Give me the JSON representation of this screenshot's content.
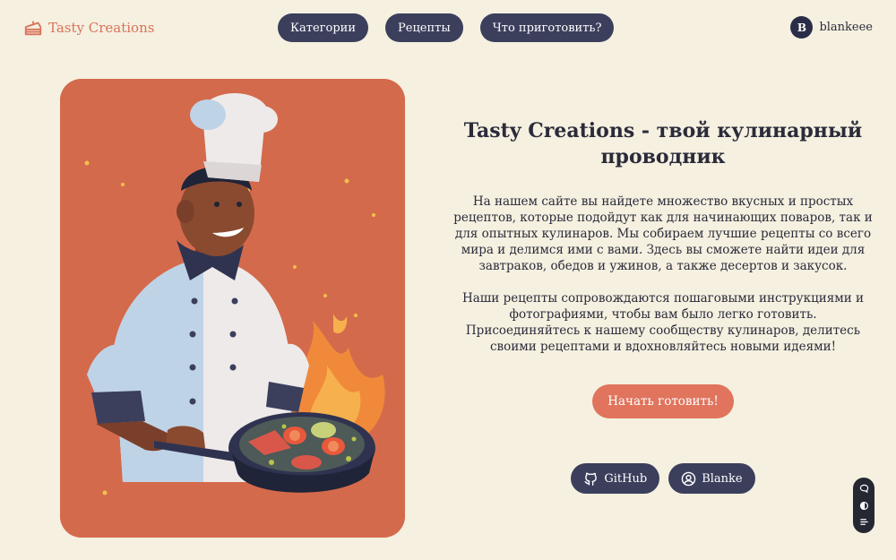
{
  "header": {
    "logo_text": "Tasty Creations",
    "logo_icon": "cake-slice-icon",
    "nav": [
      {
        "label": "Категории"
      },
      {
        "label": "Рецепты"
      },
      {
        "label": "Что приготовить?"
      }
    ],
    "user": {
      "initial": "B",
      "name": "blankeee"
    }
  },
  "hero": {
    "image": "chef-cooking-illustration"
  },
  "main": {
    "title": "Tasty Creations - твой кулинарный проводник",
    "paragraph1": "На нашем сайте вы найдете множество вкусных и простых рецептов, которые подойдут как для начинающих поваров, так и для опытных кулинаров. Мы собираем лучшие рецепты со всего мира и делимся ими с вами. Здесь вы сможете найти идеи для завтраков, обедов и ужинов, а также десертов и закусок.",
    "paragraph2": "Наши рецепты сопровождаются пошаговыми инструкциями и фотографиями, чтобы вам было легко готовить. Присоединяйтесь к нашему сообществу кулинаров, делитесь своими рецептами и вдохновляйтесь новыми идеями!",
    "cta_label": "Начать готовить!",
    "socials": [
      {
        "label": "GitHub",
        "icon": "github-icon"
      },
      {
        "label": "Blanke",
        "icon": "user-circle-icon"
      }
    ]
  },
  "colors": {
    "background": "#f5f0e0",
    "nav_bg": "#3b3f5c",
    "accent": "#e0745c",
    "logo": "#d9735a",
    "hero_bg": "#d46a4c"
  }
}
